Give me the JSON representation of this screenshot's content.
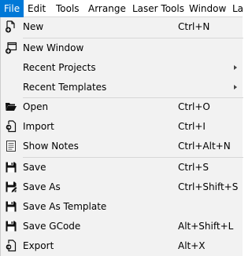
{
  "menubar": {
    "items": [
      {
        "label": "File"
      },
      {
        "label": "Edit"
      },
      {
        "label": "Tools"
      },
      {
        "label": "Arrange"
      },
      {
        "label": "Laser Tools"
      },
      {
        "label": "Window"
      },
      {
        "label": "La"
      }
    ]
  },
  "file_menu": {
    "items": [
      {
        "label": "New",
        "shortcut": "Ctrl+N",
        "icon": "new-file-icon"
      },
      {
        "label": "New Window",
        "shortcut": "",
        "icon": "new-window-icon"
      },
      {
        "label": "Recent Projects",
        "shortcut": "",
        "icon": "",
        "submenu": true
      },
      {
        "label": "Recent Templates",
        "shortcut": "",
        "icon": "",
        "submenu": true
      },
      {
        "label": "Open",
        "shortcut": "Ctrl+O",
        "icon": "folder-open-icon"
      },
      {
        "label": "Import",
        "shortcut": "Ctrl+I",
        "icon": "import-icon"
      },
      {
        "label": "Show Notes",
        "shortcut": "Ctrl+Alt+N",
        "icon": "notes-icon"
      },
      {
        "label": "Save",
        "shortcut": "Ctrl+S",
        "icon": "floppy-disk-icon"
      },
      {
        "label": "Save As",
        "shortcut": "Ctrl+Shift+S",
        "icon": "save-as-icon"
      },
      {
        "label": "Save As Template",
        "shortcut": "",
        "icon": "save-template-icon"
      },
      {
        "label": "Save GCode",
        "shortcut": "Alt+Shift+L",
        "icon": "save-gcode-icon"
      },
      {
        "label": "Export",
        "shortcut": "Alt+X",
        "icon": "export-icon"
      }
    ]
  }
}
